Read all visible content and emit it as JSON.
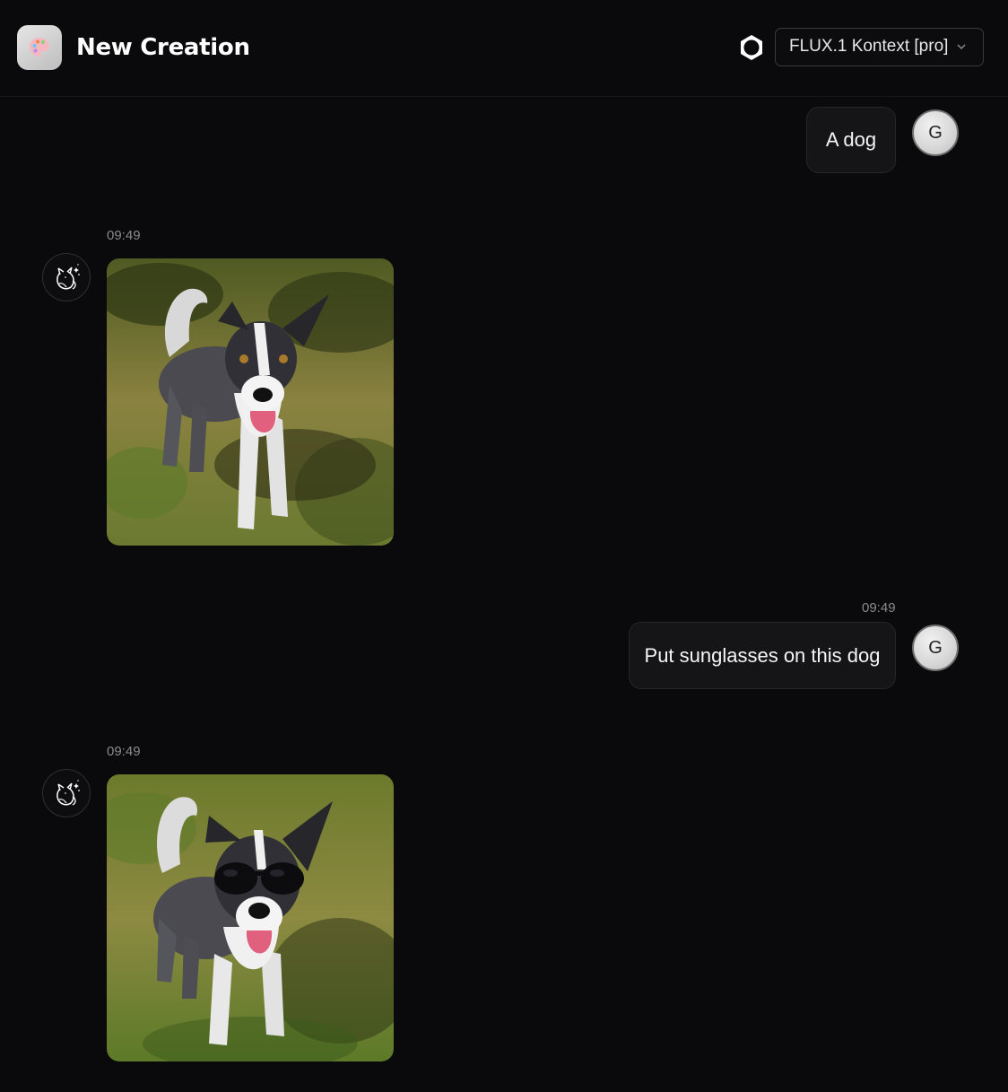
{
  "header": {
    "title": "New Creation",
    "app_icon": "palette-icon",
    "settings_icon": "gear-icon",
    "model": {
      "selected": "FLUX.1 Kontext [pro]",
      "icon": "chevron-down-icon"
    }
  },
  "messages": [
    {
      "role": "user",
      "avatar_letter": "G",
      "text": "A dog"
    },
    {
      "role": "assistant",
      "avatar_icon": "cat-logo-icon",
      "time": "09:49",
      "image": "generated image of a black and white dog standing on grass"
    },
    {
      "role": "user",
      "avatar_letter": "G",
      "time": "09:49",
      "text": "Put sunglasses on this dog"
    },
    {
      "role": "assistant",
      "avatar_icon": "cat-logo-icon",
      "time": "09:49",
      "image": "generated image of the dog wearing sunglasses"
    }
  ],
  "colors": {
    "background": "#0a0a0c",
    "bubble": "#151518",
    "timestamp": "#8a8a8e"
  }
}
